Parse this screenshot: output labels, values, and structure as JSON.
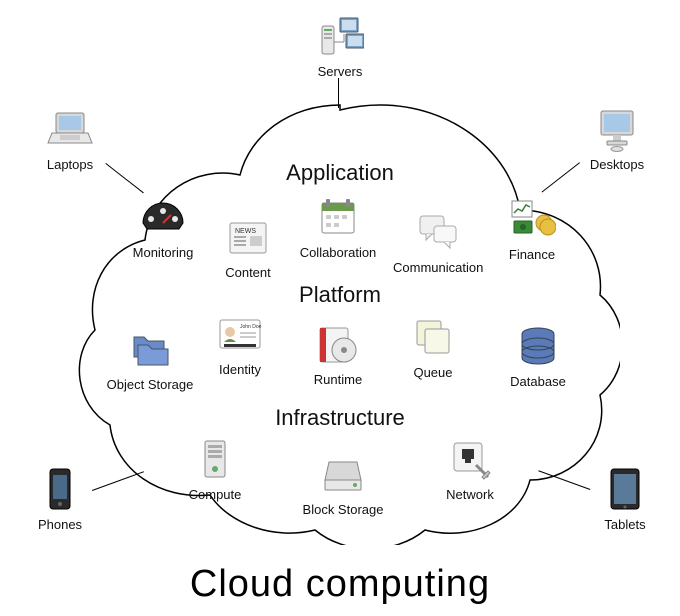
{
  "title": "Cloud computing",
  "layers": {
    "application": "Application",
    "platform": "Platform",
    "infrastructure": "Infrastructure"
  },
  "clients": {
    "servers": "Servers",
    "laptops": "Laptops",
    "desktops": "Desktops",
    "phones": "Phones",
    "tablets": "Tablets"
  },
  "application_items": {
    "monitoring": "Monitoring",
    "content": "Content",
    "collaboration": "Collaboration",
    "communication": "Communication",
    "finance": "Finance"
  },
  "platform_items": {
    "object_storage": "Object Storage",
    "identity": "Identity",
    "identity_name": "John Doe",
    "runtime": "Runtime",
    "queue": "Queue",
    "database": "Database"
  },
  "infrastructure_items": {
    "compute": "Compute",
    "block_storage": "Block Storage",
    "network": "Network"
  }
}
